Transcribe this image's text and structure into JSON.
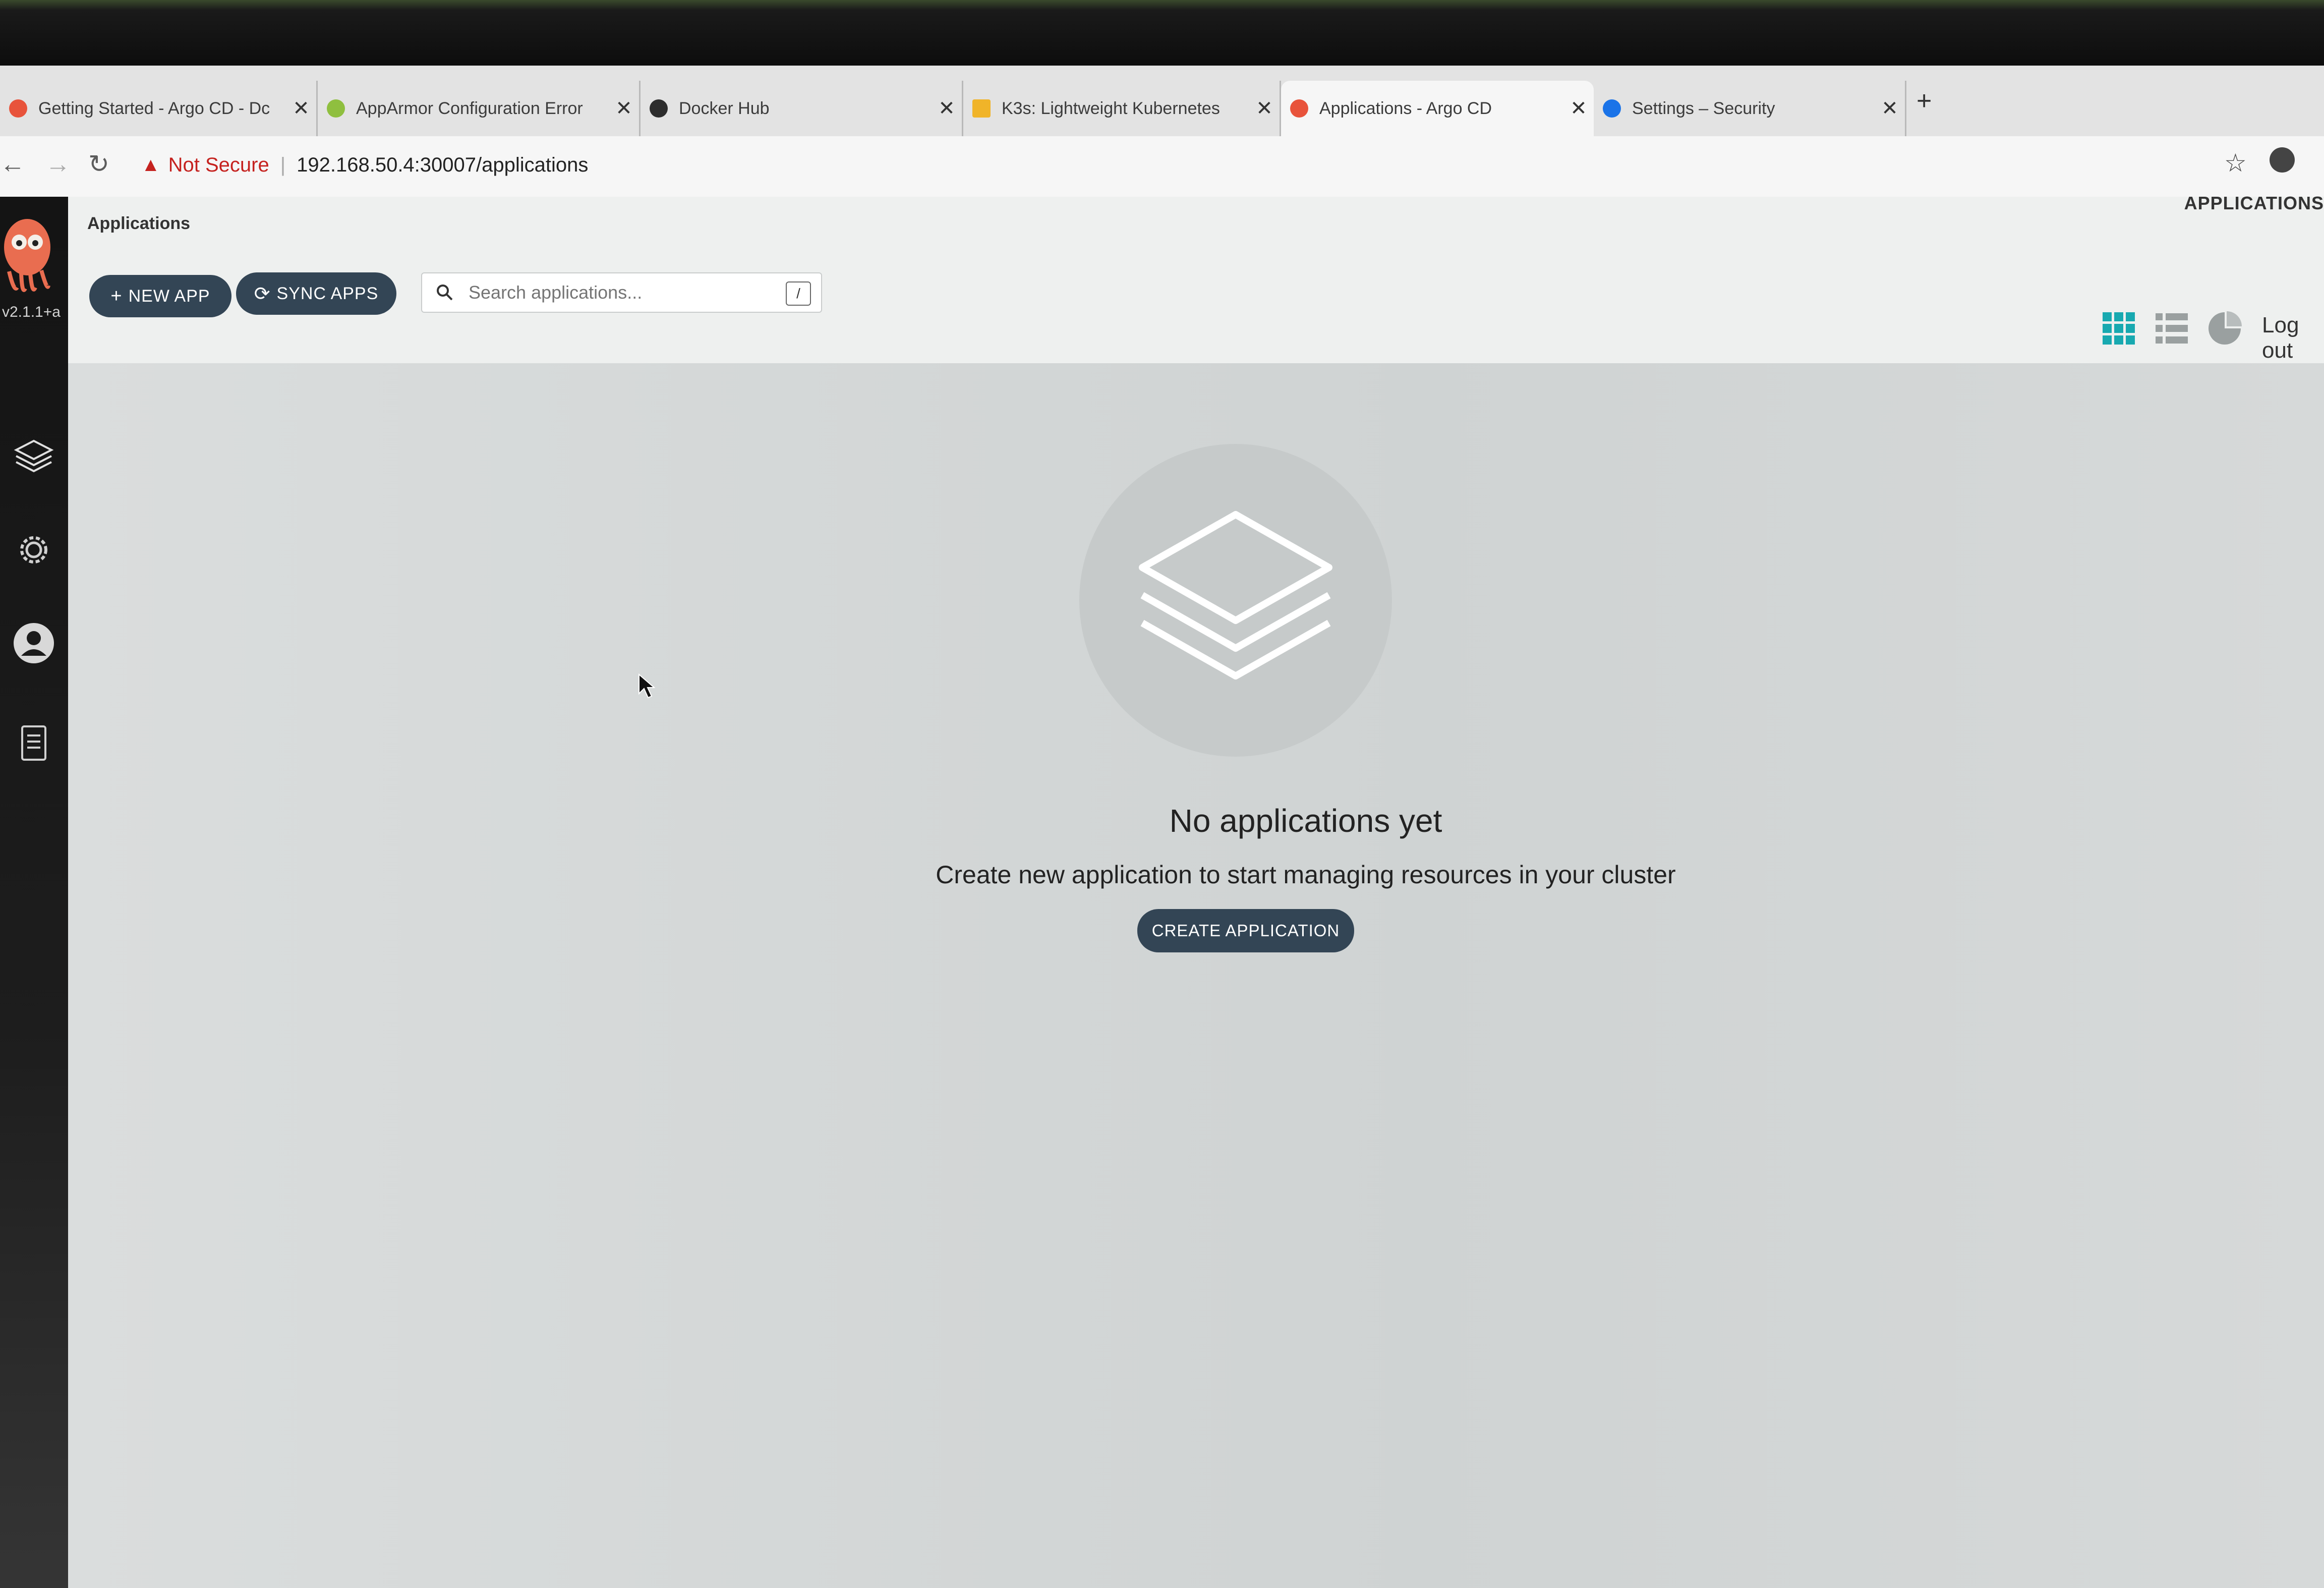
{
  "browser": {
    "tabs": [
      {
        "label": "Getting Started - Argo CD - Dc",
        "favicon_color": "#e8533b",
        "active": false
      },
      {
        "label": "AppArmor Configuration Error",
        "favicon_color": "#8fbf3f",
        "active": false
      },
      {
        "label": "Docker Hub",
        "favicon_color": "#2d2d2d",
        "active": false
      },
      {
        "label": "K3s: Lightweight Kubernetes",
        "favicon_color": "#f0b429",
        "active": false
      },
      {
        "label": "Applications - Argo CD",
        "favicon_color": "#e8533b",
        "active": true
      },
      {
        "label": "Settings – Security",
        "favicon_color": "#1a73e8",
        "active": false
      }
    ],
    "close_glyph": "✕",
    "new_tab_glyph": "+",
    "security_label": "Not Secure",
    "url": "192.168.50.4:30007/applications"
  },
  "sidebar": {
    "version": "v2.1.1+a",
    "items": [
      "layers-icon",
      "gear-icon",
      "user-icon",
      "docs-icon"
    ]
  },
  "header": {
    "breadcrumb": "Applications",
    "page_title": "APPLICATIONS",
    "new_app_label": "NEW APP",
    "sync_apps_label": "SYNC APPS",
    "search_placeholder": "Search applications...",
    "search_shortcut": "/",
    "logout_label": "Log out"
  },
  "empty_state": {
    "title": "No applications yet",
    "description": "Create new application to start managing resources in your cluster",
    "button_label": "CREATE APPLICATION"
  },
  "colors": {
    "accent": "#334555",
    "teal": "#18a9b0",
    "warning": "#c5221f"
  }
}
